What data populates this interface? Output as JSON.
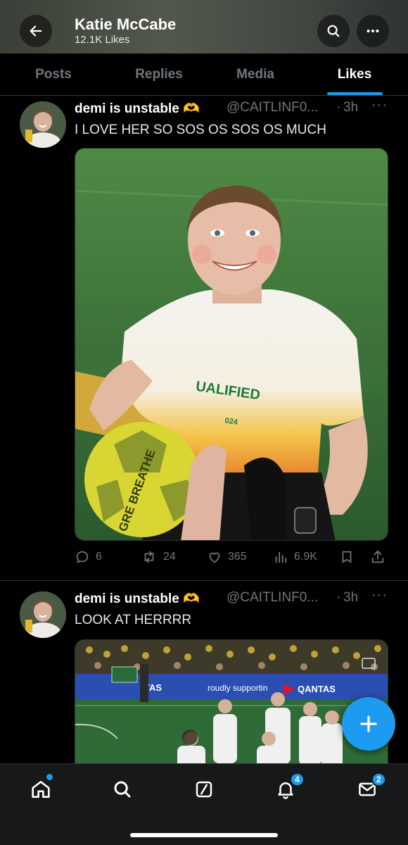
{
  "header": {
    "title": "Katie McCabe",
    "subtitle": "12.1K Likes",
    "back_icon": "arrow-left-icon",
    "search_icon": "search-icon",
    "more_icon": "more-icon"
  },
  "tabs": [
    {
      "label": "Posts",
      "active": false
    },
    {
      "label": "Replies",
      "active": false
    },
    {
      "label": "Media",
      "active": false
    },
    {
      "label": "Likes",
      "active": true
    }
  ],
  "tweets": [
    {
      "name": "demi is unstable 🫶",
      "handle": "@CAITLINF0...",
      "separator": "·",
      "time": "3h",
      "text": "I LOVE HER SO SOS OS SOS OS MUCH",
      "media_text": {
        "shirt_line1": "UALIFIED",
        "shirt_line2": "024",
        "ball_text": "GRE BREATHE"
      },
      "stats": {
        "replies": "6",
        "reposts": "24",
        "likes": "365",
        "views": "6.9K"
      }
    },
    {
      "name": "demi is unstable 🫶",
      "handle": "@CAITLINF0...",
      "separator": "·",
      "time": "3h",
      "text": "LOOK AT HERRRR",
      "media_text": {
        "board1": "roudly supportin",
        "board2": "QANTAS",
        "board3": "TAS"
      }
    }
  ],
  "fab": {
    "icon": "plus-icon"
  },
  "bottom_nav": {
    "items": [
      {
        "name": "home-icon"
      },
      {
        "name": "search-icon"
      },
      {
        "name": "grok-icon"
      },
      {
        "name": "notifications-icon",
        "badge": "4"
      },
      {
        "name": "messages-icon",
        "badge": "2"
      }
    ]
  },
  "colors": {
    "accent": "#1d9bf0",
    "muted": "#71767b",
    "background": "#000000"
  }
}
